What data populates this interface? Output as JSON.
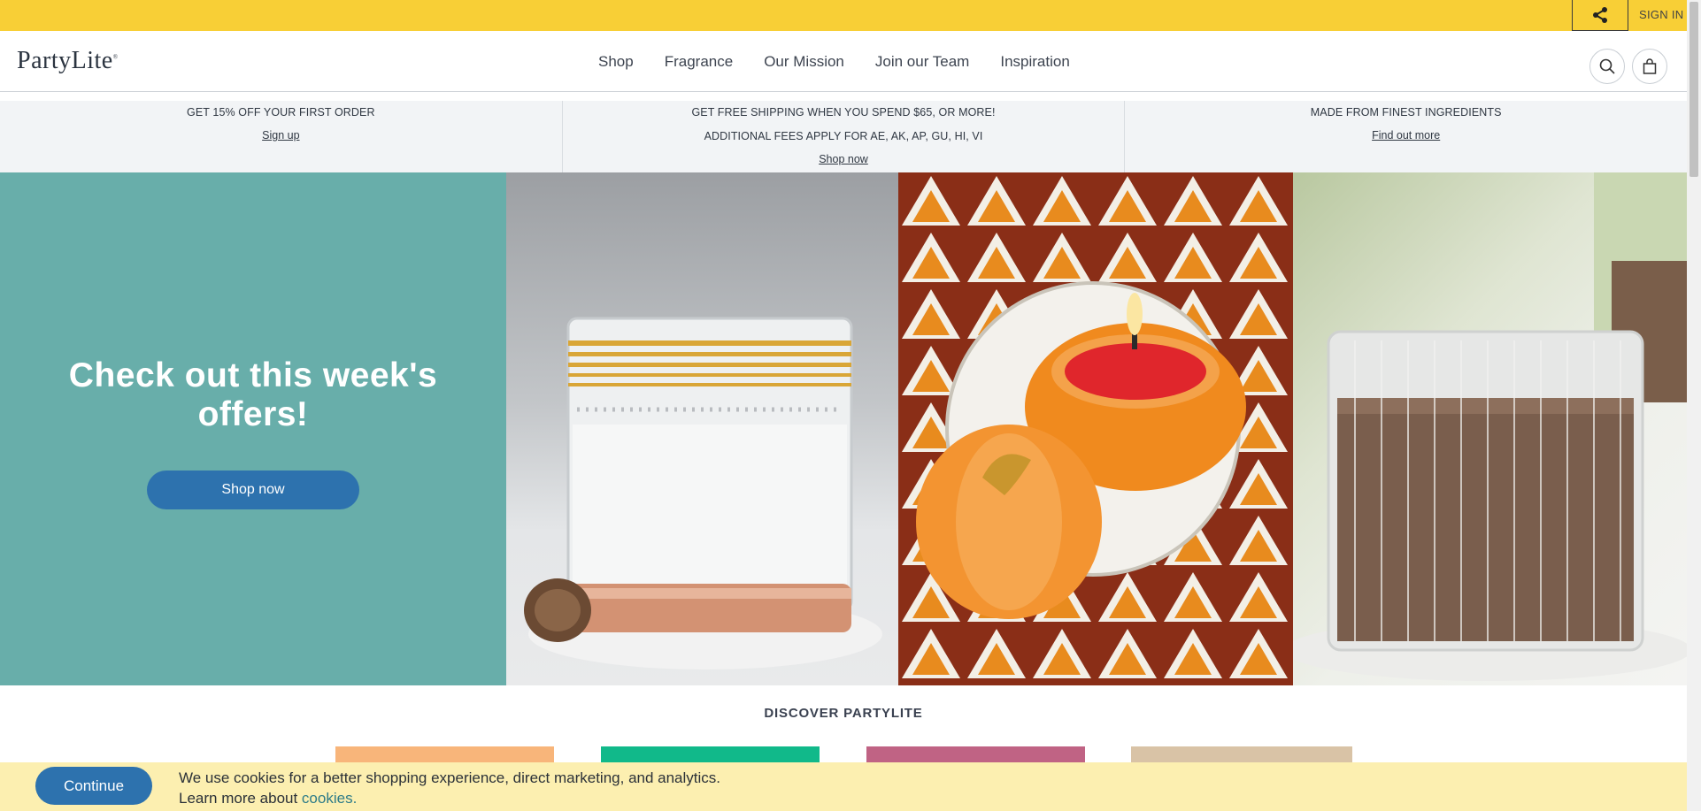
{
  "topbar": {
    "share_icon": "share-icon",
    "signin_label": "SIGN IN"
  },
  "header": {
    "logo_text": "PartyLite",
    "logo_mark": "®",
    "nav": [
      {
        "label": "Shop"
      },
      {
        "label": "Fragrance"
      },
      {
        "label": "Our Mission"
      },
      {
        "label": "Join our Team"
      },
      {
        "label": "Inspiration"
      }
    ],
    "search_icon": "search-icon",
    "cart_icon": "shopping-bag-icon"
  },
  "promo": [
    {
      "lines": [
        "GET 15% OFF YOUR FIRST ORDER"
      ],
      "link": "Sign up"
    },
    {
      "lines": [
        "GET FREE SHIPPING WHEN YOU SPEND $65, OR MORE!",
        "ADDITIONAL FEES APPLY FOR AE, AK, AP, GU, HI, VI"
      ],
      "link": "Shop now"
    },
    {
      "lines": [
        "MADE FROM FINEST INGREDIENTS"
      ],
      "link": "Find out more"
    }
  ],
  "hero": {
    "title": "Check out this week's offers!",
    "button_label": "Shop now",
    "colors": {
      "panel": "#68aeaa",
      "button": "#2d72ae"
    }
  },
  "discover": {
    "heading": "DISCOVER PARTYLITE"
  },
  "cookie": {
    "button_label": "Continue",
    "line1": "We use cookies for a better shopping experience, direct marketing, and analytics.",
    "line2_prefix": "Learn more about ",
    "line2_link": "cookies."
  },
  "colors": {
    "topbar": "#f8cf36",
    "promo_bg": "#f2f4f6",
    "cookie_bg": "#fcefb0"
  }
}
